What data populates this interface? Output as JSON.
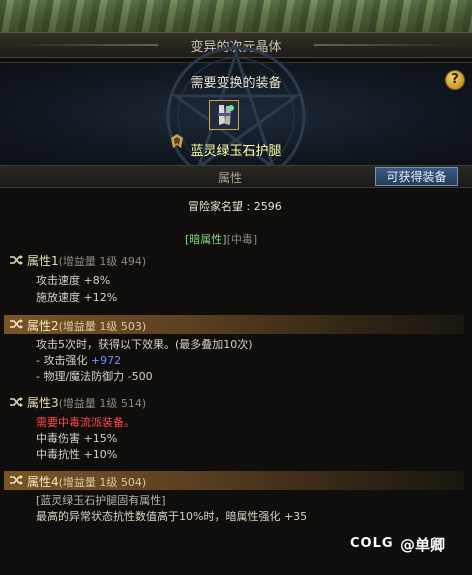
{
  "window": {
    "title": "变异的次元晶体"
  },
  "header": {
    "title": "需要变换的装备",
    "help_icon": "question-icon",
    "help_label": "?"
  },
  "item": {
    "name": "蓝灵绿玉石护腿",
    "icon": "greaves-icon"
  },
  "section": {
    "label": "属性",
    "obtain_button": "可获得装备"
  },
  "fame": {
    "label": "冒险家名望",
    "sep": " : ",
    "value": "2596"
  },
  "element": {
    "dark": "[暗属性]",
    "poison": "[中毒]"
  },
  "options": [
    {
      "name": "属性1",
      "info": "(增益量 1级 494)",
      "lines": [
        "攻击速度 +8%",
        "施放速度 +12%"
      ]
    },
    {
      "name": "属性2",
      "info": "(增益量 1级 503)",
      "lines": [
        "攻击5次时，获得以下效果。(最多叠加10次)"
      ],
      "sub1_label": "- 攻击强化 ",
      "sub1_value": "+972",
      "sub2": "- 物理/魔法防御力 -500"
    },
    {
      "name": "属性3",
      "info": "(增益量 1级 514)",
      "warning": "需要中毒流派装备。",
      "lines": [
        "中毒伤害 +15%",
        "中毒抗性 +10%"
      ]
    },
    {
      "name": "属性4",
      "info": "(增益量 1级 504)",
      "lines": [
        "[蓝灵绿玉石护腿固有属性]",
        "最高的异常状态抗性数值高于10%时，暗属性强化 +35"
      ]
    }
  ],
  "watermark": {
    "logo": "COLG",
    "handle": "@单卿"
  },
  "colors": {
    "gold": "#ffffa0",
    "text": "#d8d2c4",
    "dim": "#8f8a7e",
    "green": "#7fd67f",
    "blue": "#7d8cff",
    "red": "#ff4a4a",
    "band": "#7a5525"
  }
}
